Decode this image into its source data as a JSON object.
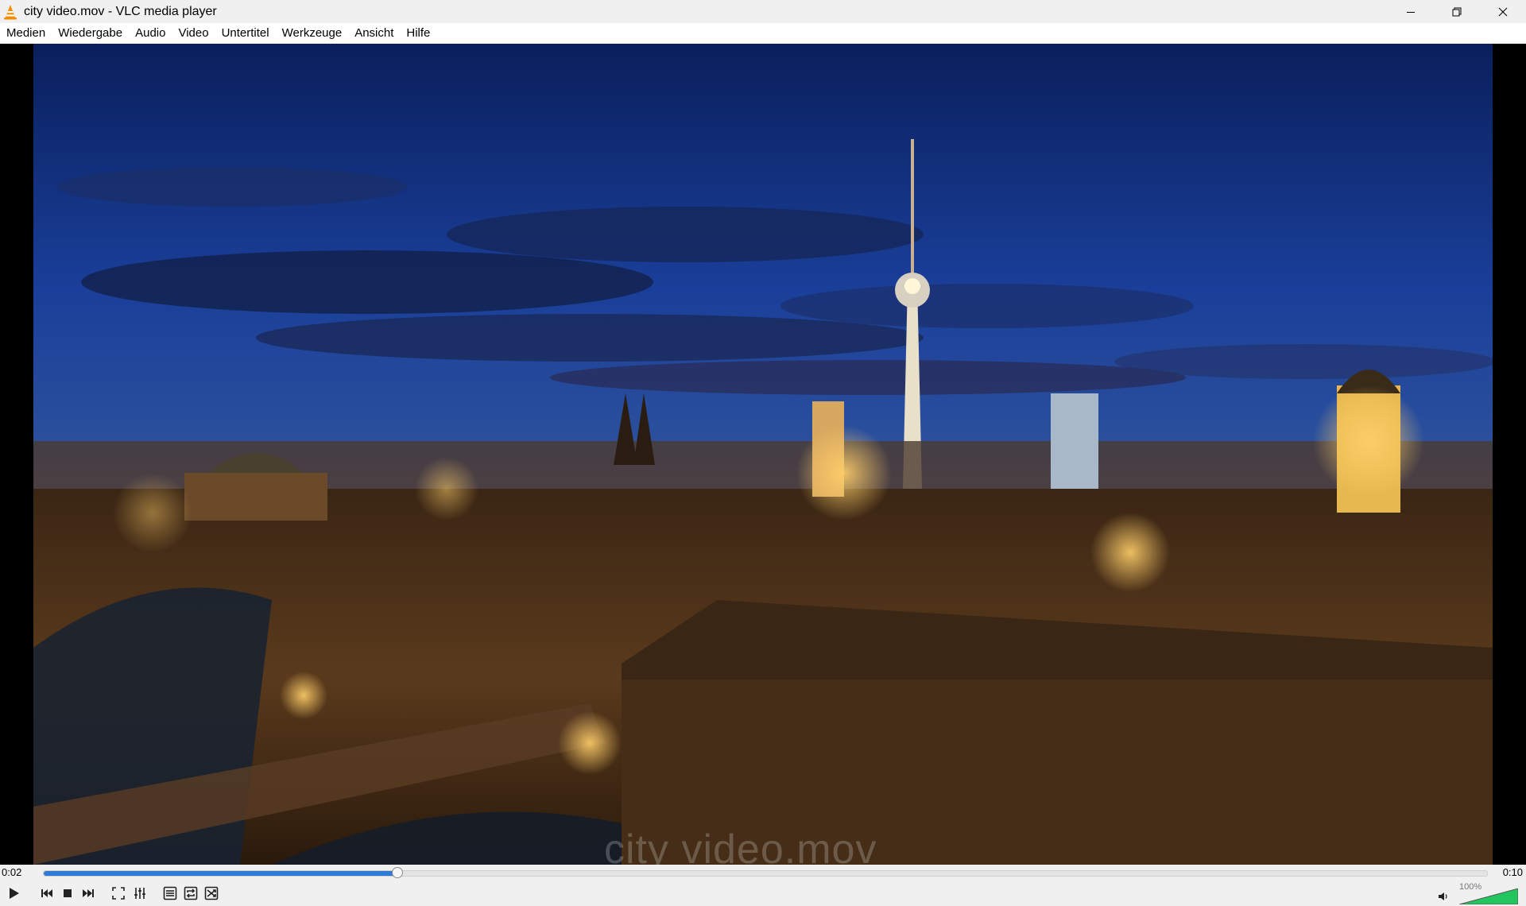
{
  "window": {
    "title": "city video.mov - VLC media player"
  },
  "menu": {
    "items": [
      "Medien",
      "Wiedergabe",
      "Audio",
      "Video",
      "Untertitel",
      "Werkzeuge",
      "Ansicht",
      "Hilfe"
    ]
  },
  "video": {
    "watermark": "city video.mov"
  },
  "playback": {
    "current_time": "0:02",
    "total_time": "0:10",
    "progress": 0.245
  },
  "controls": {
    "icons": [
      "play-icon",
      "previous-icon",
      "stop-icon",
      "next-icon",
      "fullscreen-icon",
      "extended-settings-icon",
      "playlist-icon",
      "loop-icon",
      "shuffle-icon"
    ]
  },
  "volume": {
    "label": "100%",
    "level": 1.0
  },
  "colors": {
    "seek_fill": "#2e7bd6",
    "volume_fill": "#22c55e",
    "vlc_orange": "#f28c00"
  }
}
